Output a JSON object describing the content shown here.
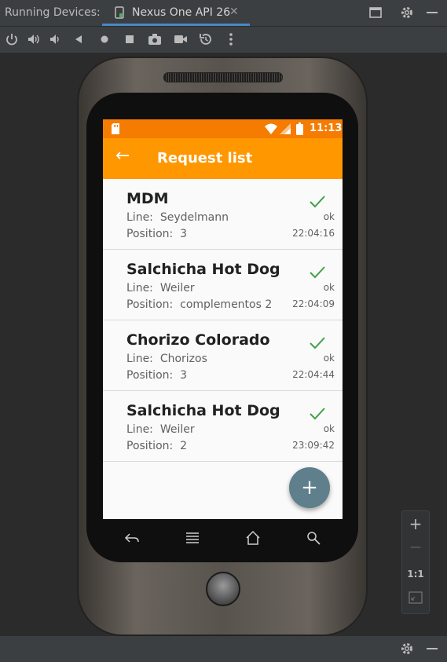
{
  "ide": {
    "panel_title": "Running Devices:",
    "device_tab_label": "Nexus One API 26",
    "tab_close": "✕",
    "zoom": {
      "plus": "+",
      "minus": "—",
      "one_to_one": "1:1"
    }
  },
  "device": {
    "status_time": "11:13",
    "app_bar": {
      "back_glyph": "←",
      "title": "Request list"
    },
    "line_label": "Line:",
    "position_label": "Position:",
    "requests": [
      {
        "name": "MDM",
        "line": "Seydelmann",
        "position": "3",
        "status": "ok",
        "time": "22:04:16"
      },
      {
        "name": "Salchicha Hot Dog",
        "line": "Weiler",
        "position": "complementos 2",
        "status": "ok",
        "time": "22:04:09"
      },
      {
        "name": "Chorizo Colorado",
        "line": "Chorizos",
        "position": "3",
        "status": "ok",
        "time": "22:04:44"
      },
      {
        "name": "Salchicha Hot Dog",
        "line": "Weiler",
        "position": "2",
        "status": "ok",
        "time": "23:09:42"
      }
    ],
    "fab_glyph": "+"
  },
  "colors": {
    "status_bar": "#f57c00",
    "app_bar": "#ff9800",
    "check": "#43a047",
    "fab": "#5f7f8c"
  }
}
